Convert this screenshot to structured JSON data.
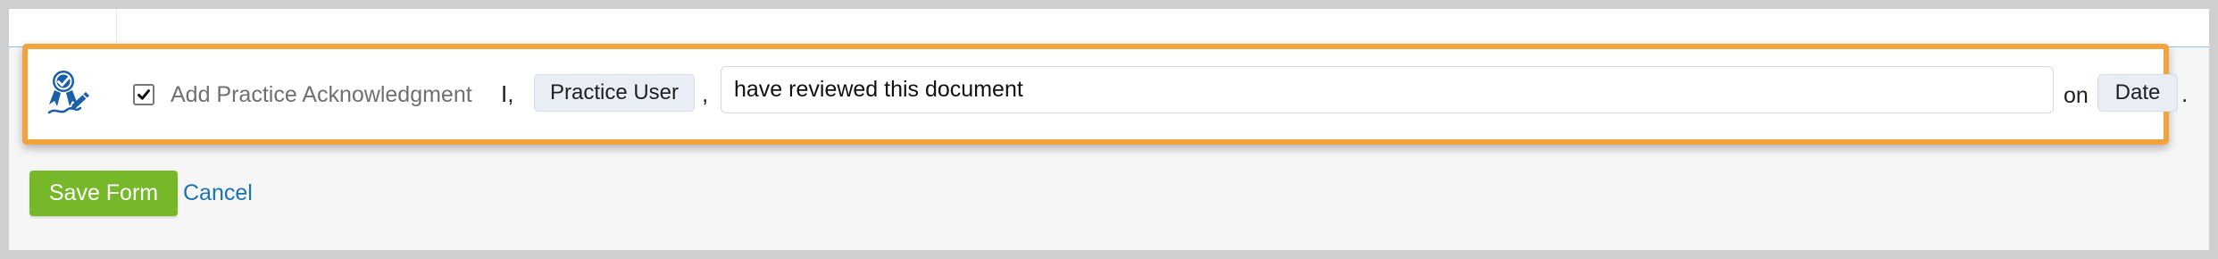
{
  "acknowledgment": {
    "checkbox_checked": true,
    "label": "Add Practice Acknowledgment",
    "prefix": "I,",
    "user_token": "Practice User",
    "comma": ",",
    "statement_value": "have reviewed this document",
    "on_label": "on",
    "date_token": "Date",
    "period": "."
  },
  "actions": {
    "save_label": "Save Form",
    "cancel_label": "Cancel"
  },
  "icons": {
    "practice_badge": "verified-badge-signature-icon",
    "checkbox": "checkmark-icon"
  },
  "colors": {
    "highlight": "#f4a23a",
    "save_button": "#76b82a",
    "link": "#1a73b5",
    "token_background": "#e9edf6",
    "badge_icon": "#1a5fa8"
  }
}
